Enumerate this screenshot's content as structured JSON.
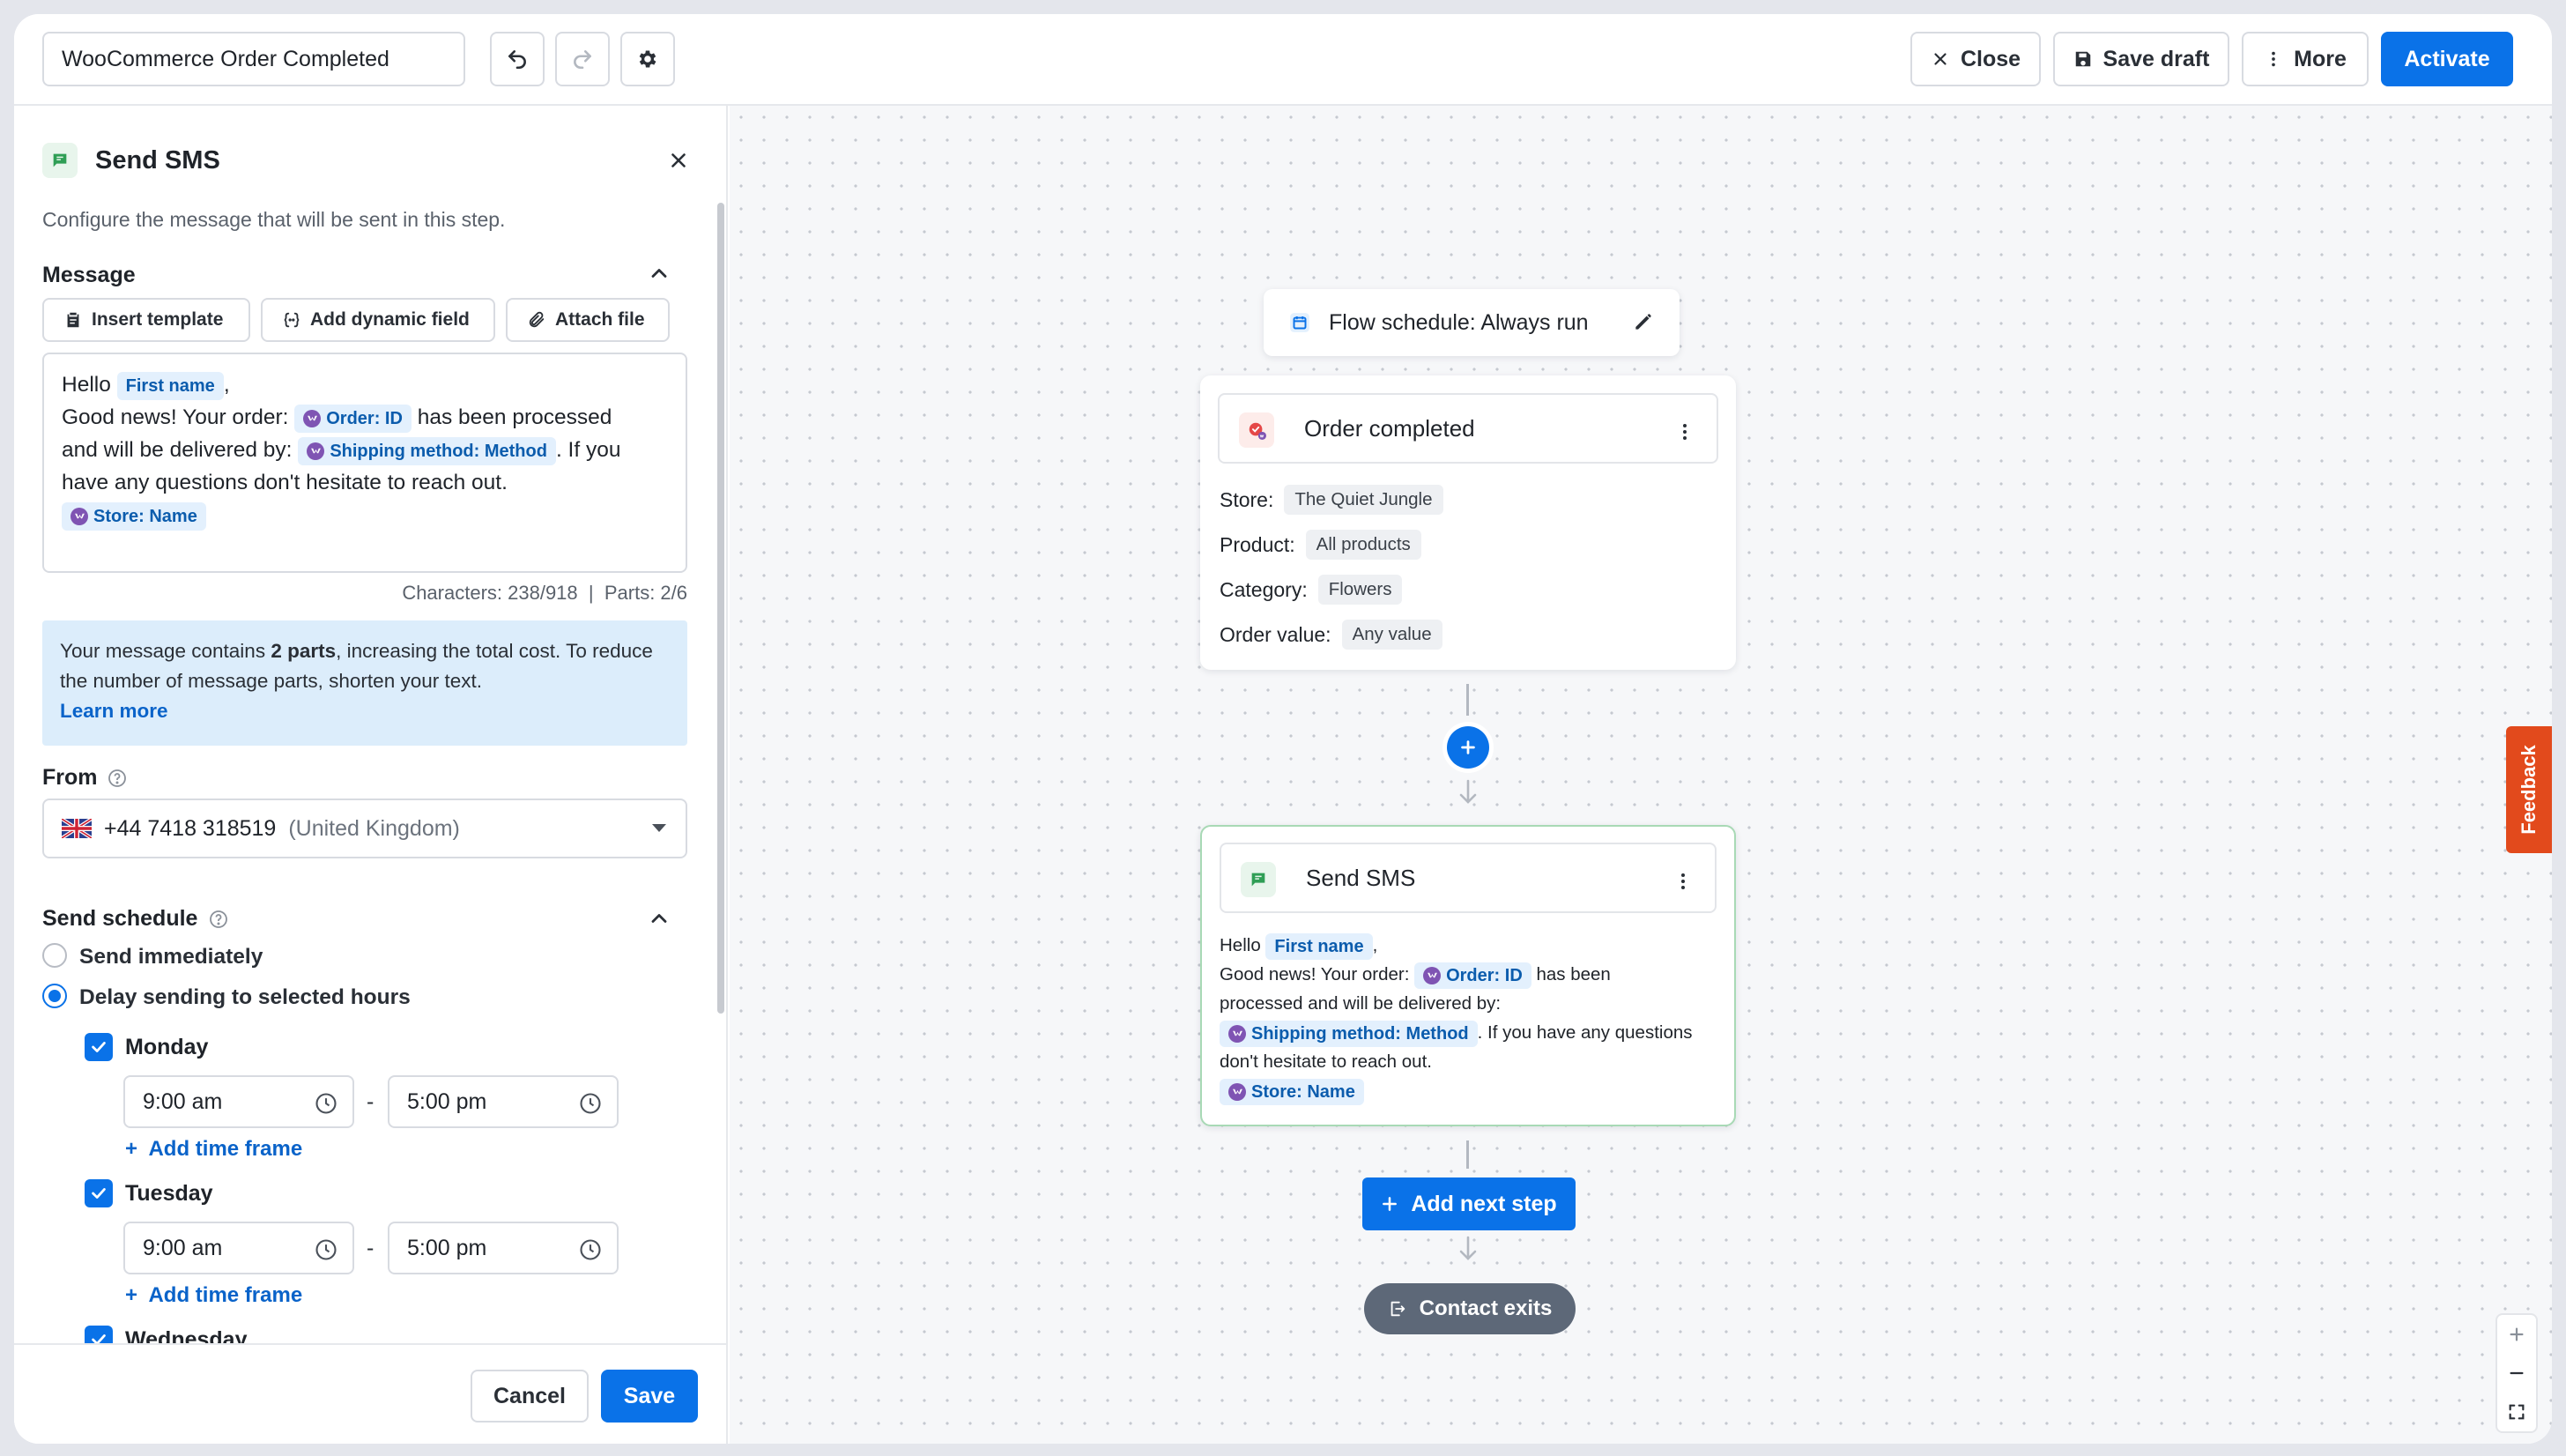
{
  "topbar": {
    "flow_title": "WooCommerce Order Completed",
    "close_label": "Close",
    "save_draft_label": "Save draft",
    "more_label": "More",
    "activate_label": "Activate"
  },
  "panel": {
    "title": "Send SMS",
    "description": "Configure the message that will be sent in this step.",
    "message_section": "Message",
    "tools": {
      "insert_template": "Insert template",
      "add_dynamic_field": "Add dynamic field",
      "attach_file": "Attach file"
    },
    "message": {
      "hello": "Hello",
      "first_name": "First name",
      "comma": ",",
      "line2_pre": "Good news! Your order:",
      "order_id": "Order: ID",
      "line2_post": "has been processed",
      "line3_pre": "and will be delivered by:",
      "shipping": "Shipping method: Method",
      "line3_post": ". If you",
      "line4": "have any questions don't hesitate to reach out.",
      "store": "Store: Name"
    },
    "counts": {
      "characters": "Characters: 238/918",
      "separator": "|",
      "parts": "Parts: 2/6"
    },
    "info": {
      "pre": "Your message contains ",
      "bold": "2 parts",
      "post": ", increasing the total cost. To reduce the number of message parts, shorten your text.",
      "link": "Learn more"
    },
    "from_label": "From",
    "from_number": "+44 7418 318519",
    "from_country": "(United Kingdom)",
    "schedule_section": "Send schedule",
    "send_immediately": "Send immediately",
    "delay_sending": "Delay sending to selected hours",
    "days": [
      {
        "name": "Monday",
        "start": "9:00 am",
        "end": "5:00 pm",
        "add": "Add time frame"
      },
      {
        "name": "Tuesday",
        "start": "9:00 am",
        "end": "5:00 pm",
        "add": "Add time frame"
      },
      {
        "name": "Wednesday"
      }
    ],
    "dash": "-",
    "cancel_label": "Cancel",
    "save_label": "Save"
  },
  "canvas": {
    "schedule_label": "Flow schedule: Always run",
    "trigger": {
      "title": "Order completed",
      "rows": [
        {
          "key": "Store:",
          "value": "The Quiet Jungle"
        },
        {
          "key": "Product:",
          "value": "All products"
        },
        {
          "key": "Category:",
          "value": "Flowers"
        },
        {
          "key": "Order value:",
          "value": "Any value"
        }
      ]
    },
    "sms": {
      "title": "Send SMS",
      "hello": "Hello",
      "first_name": "First name",
      "comma": ",",
      "l2_pre": "Good news! Your order:",
      "order_id": "Order: ID",
      "l2_post": "has been",
      "l3": "processed and will be delivered by:",
      "shipping": "Shipping method: Method",
      "l4_post": ". If you have any questions",
      "l5": "don't hesitate to reach out.",
      "store": "Store: Name"
    },
    "add_next_step": "Add next step",
    "contact_exits": "Contact exits",
    "feedback": "Feedback"
  },
  "colors": {
    "accent": "#0a72e8",
    "feedback": "#e24a1c",
    "exit_pill": "#5d6878",
    "chip_bg": "#e3f0fd",
    "woo_purple": "#7f54b3"
  }
}
